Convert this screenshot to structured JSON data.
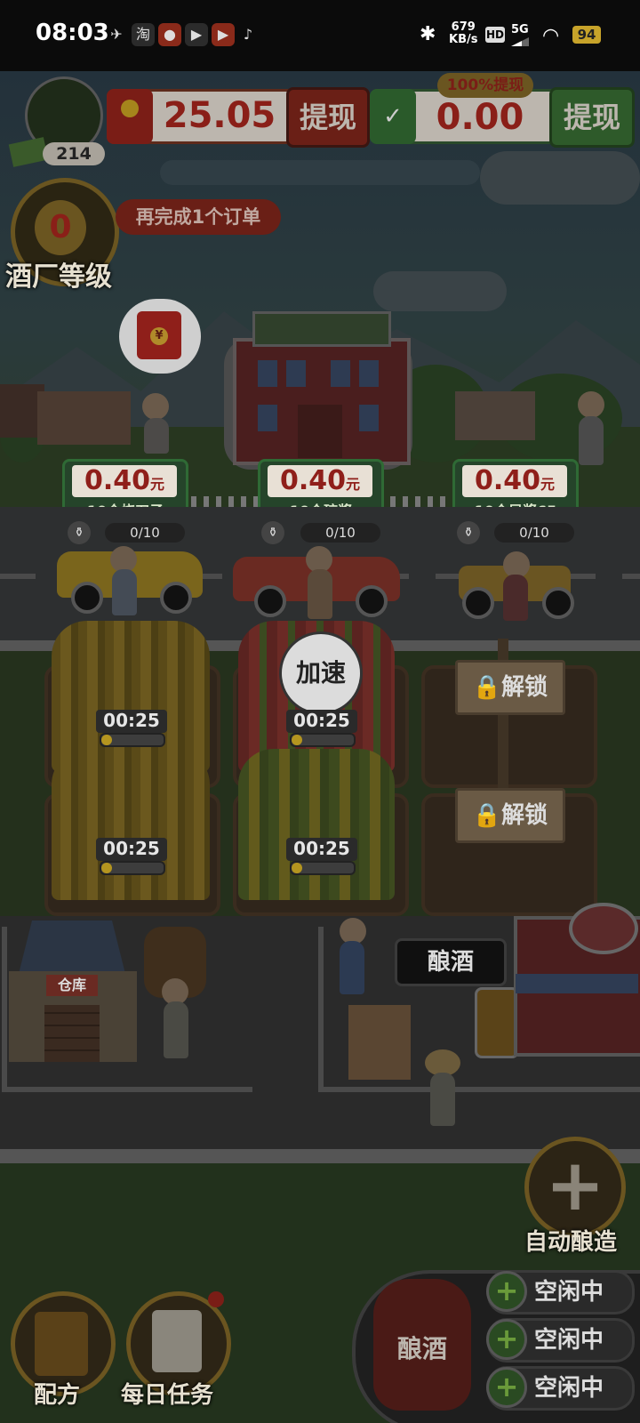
{
  "status_bar": {
    "time": "08:03",
    "net_speed": "679",
    "net_unit": "KB/s",
    "hd": "HD",
    "network": "5G",
    "battery": "94",
    "app_icons": [
      "taobao-icon",
      "app-icon",
      "video-icon",
      "video2-icon",
      "tiktok-icon"
    ]
  },
  "header": {
    "coins": "214",
    "red_balance": "25.05",
    "red_withdraw": "提现",
    "wechat_badge": "100%提现",
    "wechat_balance": "0.00",
    "wechat_withdraw": "提现"
  },
  "level": {
    "value": "0",
    "label": "酒厂等级",
    "hint": "再完成1个订单"
  },
  "orders": [
    {
      "price": "0.40",
      "unit": "元",
      "item": "10个烧刀子",
      "progress": "0/10"
    },
    {
      "price": "0.40",
      "unit": "元",
      "item": "10个琼浆",
      "progress": "0/10"
    },
    {
      "price": "0.40",
      "unit": "元",
      "item": "10个凤浆65",
      "progress": "0/10"
    }
  ],
  "fields": {
    "speed_up": "加速",
    "timers": [
      "00:25",
      "00:25",
      "00:25",
      "00:25"
    ],
    "unlock_labels": [
      "解锁",
      "解锁"
    ]
  },
  "factory": {
    "warehouse": "仓库",
    "brew_button": "酿酒"
  },
  "controls": {
    "auto_brew": "自动酿造",
    "recipe": "配方",
    "daily_tasks": "每日任务",
    "jar_label": "酿酒",
    "slots": [
      "空闲中",
      "空闲中",
      "空闲中"
    ]
  },
  "colors": {
    "red": "#8f1f1a",
    "green": "#2f6a35",
    "gold": "#b4951f",
    "overlay": "dimmed"
  }
}
